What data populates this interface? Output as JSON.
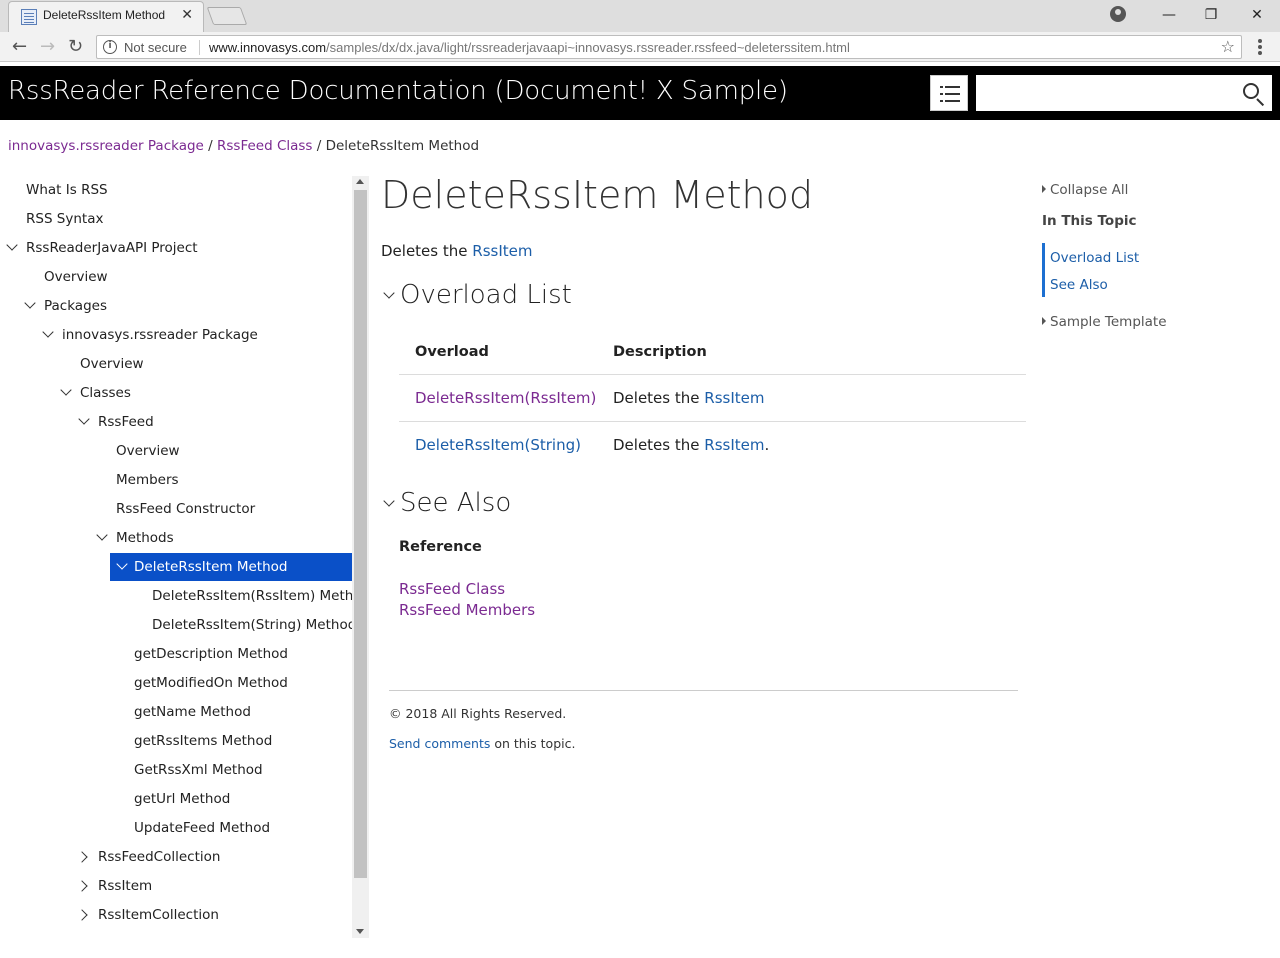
{
  "browser": {
    "tab_title": "DeleteRssItem Method",
    "not_secure": "Not secure",
    "url_host": "www.innovasys.com",
    "url_path": "/samples/dx/dx.java/light/rssreaderjavaapi~innovasys.rssreader.rssfeed~deleterssitem.html"
  },
  "header": {
    "title": "RssReader Reference Documentation (Document! X Sample)",
    "search_placeholder": ""
  },
  "breadcrumb": {
    "items": [
      "innovasys.rssreader Package",
      "RssFeed Class"
    ],
    "separator": " / ",
    "current": "DeleteRssItem Method"
  },
  "toc": {
    "items": [
      {
        "label": "What Is RSS",
        "level": 0
      },
      {
        "label": "RSS Syntax",
        "level": 0
      },
      {
        "label": "RssReaderJavaAPI Project",
        "level": 0,
        "expander": "down"
      },
      {
        "label": "Overview",
        "level": 1
      },
      {
        "label": "Packages",
        "level": 1,
        "expander": "down"
      },
      {
        "label": "innovasys.rssreader Package",
        "level": 2,
        "expander": "down"
      },
      {
        "label": "Overview",
        "level": 3
      },
      {
        "label": "Classes",
        "level": 3,
        "expander": "down"
      },
      {
        "label": "RssFeed",
        "level": 4,
        "expander": "down"
      },
      {
        "label": "Overview",
        "level": 5
      },
      {
        "label": "Members",
        "level": 5
      },
      {
        "label": "RssFeed Constructor",
        "level": 5
      },
      {
        "label": "Methods",
        "level": 5,
        "expander": "down"
      },
      {
        "label": "DeleteRssItem Method",
        "level": 6,
        "expander": "down",
        "selected": true
      },
      {
        "label": "DeleteRssItem(RssItem) Method",
        "level": 7
      },
      {
        "label": "DeleteRssItem(String) Method",
        "level": 7
      },
      {
        "label": "getDescription Method",
        "level": 6
      },
      {
        "label": "getModifiedOn Method",
        "level": 6
      },
      {
        "label": "getName Method",
        "level": 6
      },
      {
        "label": "getRssItems Method",
        "level": 6
      },
      {
        "label": "GetRssXml Method",
        "level": 6
      },
      {
        "label": "getUrl Method",
        "level": 6
      },
      {
        "label": "UpdateFeed Method",
        "level": 6
      },
      {
        "label": "RssFeedCollection",
        "level": 4,
        "expander": "right"
      },
      {
        "label": "RssItem",
        "level": 4,
        "expander": "right"
      },
      {
        "label": "RssItemCollection",
        "level": 4,
        "expander": "right"
      }
    ]
  },
  "main": {
    "title": "DeleteRssItem Method",
    "summary_prefix": "Deletes the ",
    "summary_link": "RssItem",
    "overload_heading": "Overload List",
    "col_overload": "Overload",
    "col_description": "Description",
    "overloads": [
      {
        "name": "DeleteRssItem(RssItem)",
        "desc_prefix": "Deletes the ",
        "desc_link": "RssItem",
        "desc_suffix": ""
      },
      {
        "name": "DeleteRssItem(String)",
        "desc_prefix": "Deletes the ",
        "desc_link": "RssItem",
        "desc_suffix": "."
      }
    ],
    "see_also_heading": "See Also",
    "reference_label": "Reference",
    "references": [
      "RssFeed Class",
      "RssFeed Members"
    ],
    "copyright": "© 2018 All Rights Reserved.",
    "send_comments": "Send comments",
    "comments_suffix": " on this topic."
  },
  "right_panel": {
    "collapse_all": "Collapse All",
    "in_this_topic": "In This Topic",
    "links": [
      "Overload List",
      "See Also"
    ],
    "sample_template": "Sample Template"
  },
  "colors": {
    "link": "#1c5ea8",
    "visited": "#7b2a91",
    "selected_bg": "#0a50c8",
    "header_bg": "#000000"
  }
}
